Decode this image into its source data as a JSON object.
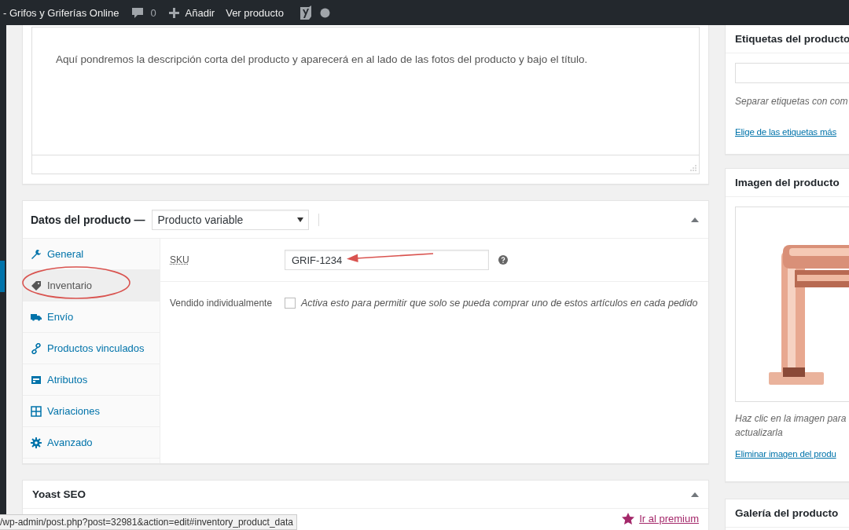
{
  "admin_bar": {
    "site_name": "- Grifos y Griferías Online",
    "comments": "0",
    "add_new": "Añadir",
    "view": "Ver producto"
  },
  "short_description": {
    "text": "Aquí pondremos la descripción corta del producto y aparecerá en al lado de las fotos del producto y bajo el título."
  },
  "product_data": {
    "title": "Datos del producto —",
    "product_type": "Producto variable",
    "expanded": true,
    "tabs": [
      {
        "label": "General",
        "kind": "wrench",
        "selected": false
      },
      {
        "label": "Inventario",
        "kind": "tag",
        "selected": true
      },
      {
        "label": "Envío",
        "kind": "truck",
        "selected": false
      },
      {
        "label": "Productos vinculados",
        "kind": "link",
        "selected": false
      },
      {
        "label": "Atributos",
        "kind": "list",
        "selected": false
      },
      {
        "label": "Variaciones",
        "kind": "grid",
        "selected": false
      },
      {
        "label": "Avanzado",
        "kind": "gear",
        "selected": false
      }
    ],
    "sku": {
      "label": "SKU",
      "value": "GRIF-1234"
    },
    "sold_individually": {
      "label": "Vendido individualmente",
      "checked": false,
      "description": "Activa esto para permitir que solo se pueda comprar uno de estos artículos en cada pedido"
    }
  },
  "yoast": {
    "title": "Yoast SEO",
    "expanded": true,
    "premium_link": "Ir al premium"
  },
  "status_url": "/wp-admin/post.php?post=32981&action=edit#inventory_product_data",
  "tags_box": {
    "title": "Etiquetas del producto",
    "hint": "Separar etiquetas con com",
    "link": "Elige de las etiquetas más"
  },
  "image_box": {
    "title": "Imagen del producto",
    "hint_lines": [
      "Haz clic en la imagen para",
      "actualizarla"
    ],
    "link": "Eliminar imagen del produ"
  },
  "gallery_box": {
    "title": "Galería del producto"
  }
}
